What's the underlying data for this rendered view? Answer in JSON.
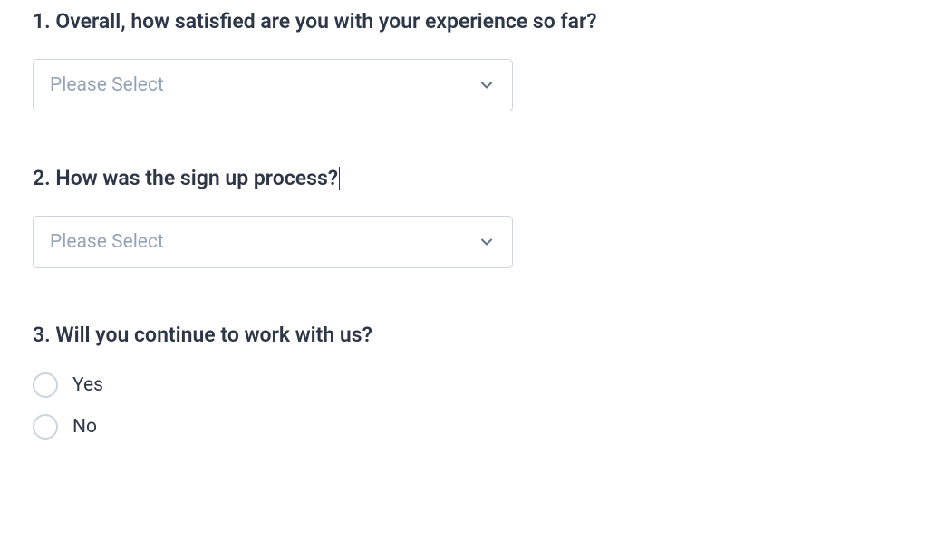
{
  "questions": [
    {
      "number": "1.",
      "text": "Overall, how satisfied are you with your experience so far?",
      "type": "select",
      "placeholder": "Please Select",
      "has_cursor": false
    },
    {
      "number": "2.",
      "text": "How was the sign up process?",
      "type": "select",
      "placeholder": "Please Select",
      "has_cursor": true
    },
    {
      "number": "3.",
      "text": "Will you continue to work with us?",
      "type": "radio",
      "options": [
        "Yes",
        "No"
      ]
    }
  ]
}
